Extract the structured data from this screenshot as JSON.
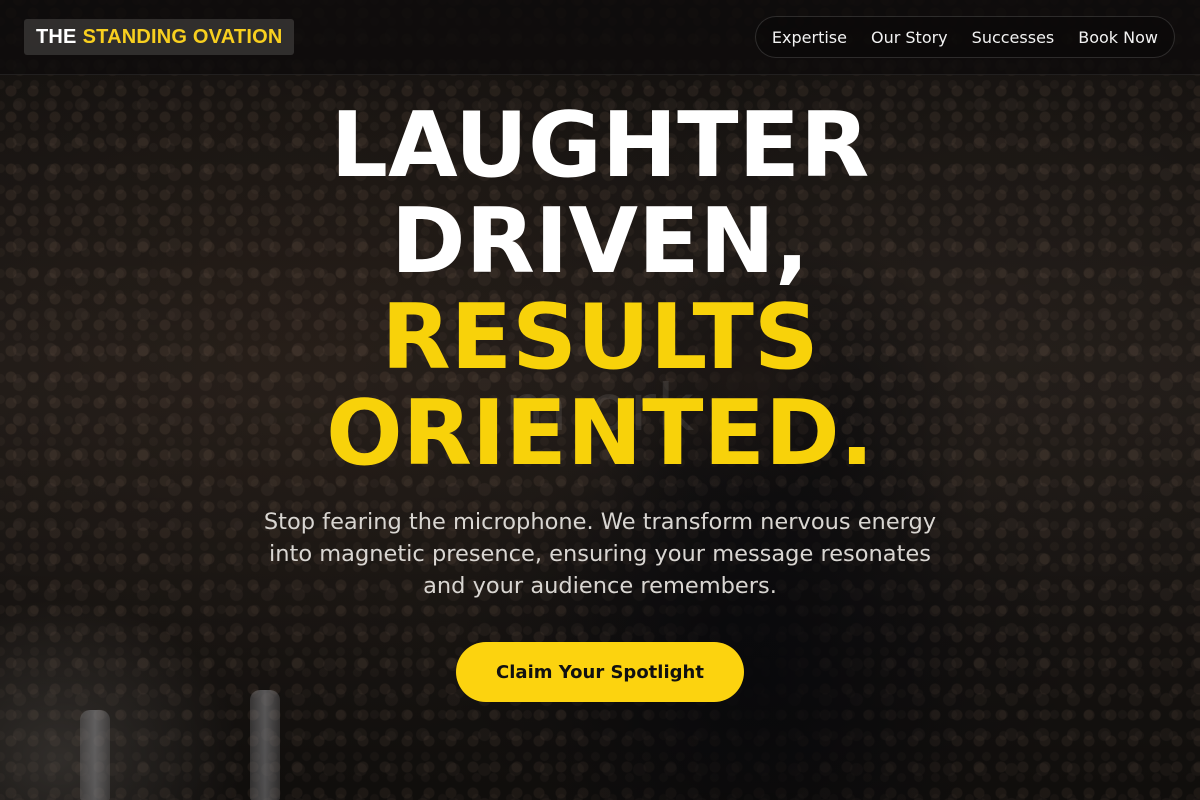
{
  "brand": {
    "prefix": "THE",
    "name": "STANDING OVATION"
  },
  "nav": {
    "items": [
      {
        "label": "Expertise"
      },
      {
        "label": "Our Story"
      },
      {
        "label": "Successes"
      },
      {
        "label": "Book Now"
      }
    ]
  },
  "hero": {
    "headline": [
      "LAUGHTER",
      "DRIVEN,",
      "RESULTS",
      "ORIENTED."
    ],
    "background_watermark": "m                     ork",
    "subtitle": "Stop fearing the microphone. We transform nervous energy into magnetic presence, ensuring your message resonates and your audience remembers.",
    "cta_label": "Claim Your Spotlight"
  },
  "colors": {
    "accent": "#f8d20a",
    "headline_white": "#ffffff",
    "nav_background": "#0e0c0c"
  }
}
